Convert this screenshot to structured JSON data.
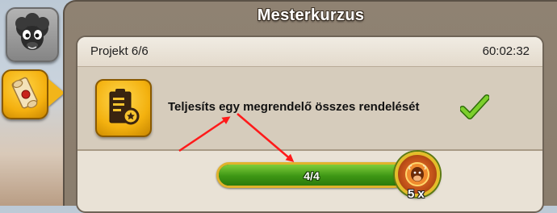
{
  "window": {
    "title": "Mesterkurzus"
  },
  "side_buttons": [
    {
      "icon": "sheep-avatar-icon"
    },
    {
      "icon": "scroll-icon"
    }
  ],
  "project": {
    "label": "Projekt 6/6",
    "timer": "60:02:32"
  },
  "task": {
    "icon": "certificate-icon",
    "text": "Teljesíts egy megrendelő összes rendelését",
    "status_icon": "check-icon"
  },
  "progress": {
    "current": 4,
    "total": 4,
    "fraction": 1.0,
    "text": "4/4",
    "fill_color": "#3d9614"
  },
  "reward": {
    "icon": "cow-medal-icon",
    "count_text": "5 x"
  },
  "annotation": {
    "color": "#ff1a1a",
    "arrows": [
      "pointing-to-task-text",
      "pointing-to-progress-bar"
    ]
  }
}
